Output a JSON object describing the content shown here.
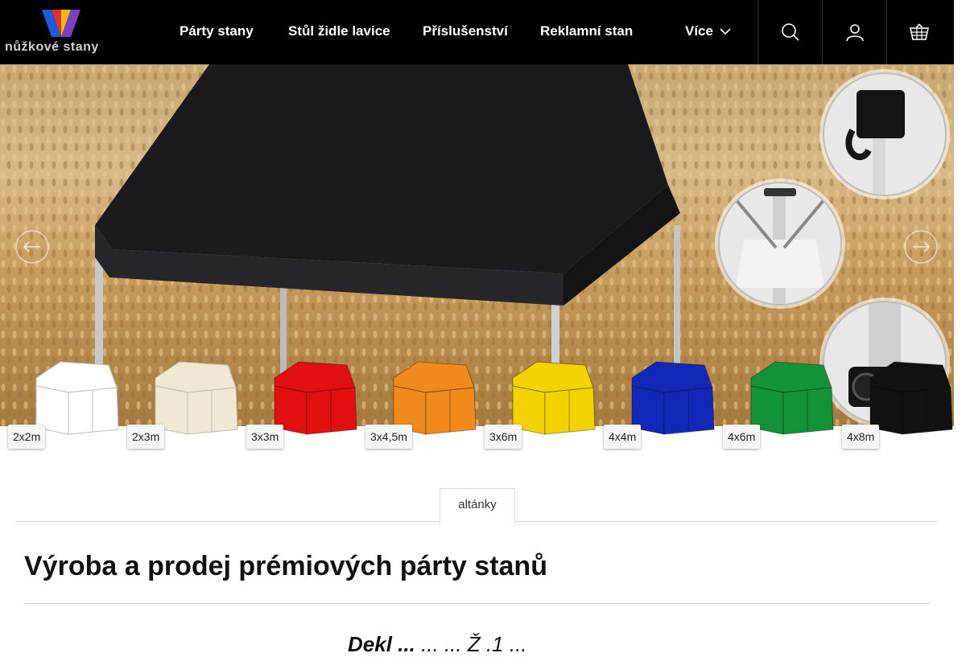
{
  "logo": {
    "text": "nůžkové stany"
  },
  "nav": {
    "items": [
      "Párty stany",
      "Stůl židle lavice",
      "Příslušenství",
      "Reklamní stan"
    ],
    "more_label": "Více"
  },
  "header_icons": [
    "search-icon",
    "user-icon",
    "cart-icon"
  ],
  "slider": {
    "prev_icon": "arrow-left-icon",
    "next_icon": "arrow-right-icon"
  },
  "sizes": [
    {
      "label": "2x2m",
      "color": "#ffffff"
    },
    {
      "label": "2x3m",
      "color": "#efe8d3"
    },
    {
      "label": "3x3m",
      "color": "#e01010"
    },
    {
      "label": "3x4,5m",
      "color": "#f08a1c"
    },
    {
      "label": "3x6m",
      "color": "#f2d200"
    },
    {
      "label": "4x4m",
      "color": "#1428b8"
    },
    {
      "label": "4x6m",
      "color": "#14923a"
    },
    {
      "label": "4x8m",
      "color": "#111111"
    }
  ],
  "tabs": {
    "active": "altánky"
  },
  "page": {
    "title": "Výroba a prodej prémiových párty stanů",
    "subtitle_bold": "Dekl ...",
    "subtitle_rest": "...  ...  Ž .1 ..."
  }
}
